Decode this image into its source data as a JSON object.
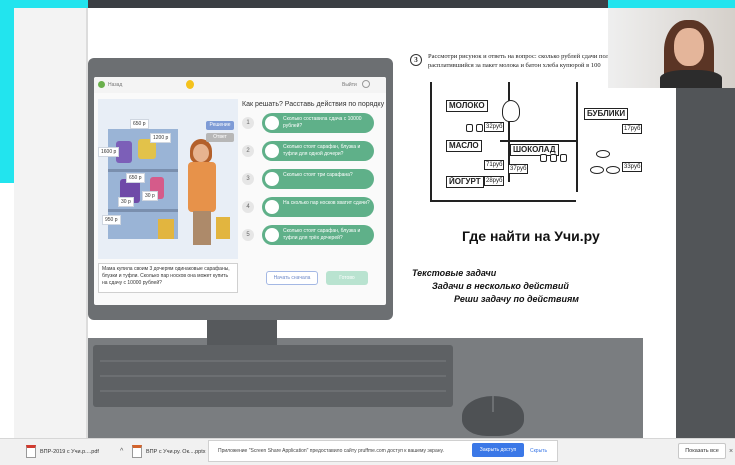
{
  "colors": {
    "cyan_frame": "#22e4ee",
    "step_green": "#5fb089",
    "share_blue": "#3b78e7",
    "monitor_gray": "#6c6f72"
  },
  "uchi_screen": {
    "back_label": "Назад",
    "exit_label": "Выйти",
    "question_title": "Как решать? Расставь действия по порядку",
    "prices": [
      "650 р",
      "1200 р",
      "1600 р",
      "650 р",
      "30 р",
      "30 р",
      "950 р"
    ],
    "side_tags": [
      "Решение",
      "Ответ"
    ],
    "task_text": "Мама купила своим 3 дочерям одинаковые сарафаны, блузки и туфли. Сколько пар носков она может купить на сдачу с 10000 рублей?",
    "steps": [
      {
        "num": "1",
        "text": "Сколько составила сдача с 10000 рублей?"
      },
      {
        "num": "2",
        "text": "Сколько стоят сарафан, блузка и туфли для одной дочери?"
      },
      {
        "num": "3",
        "text": "Сколько стоят три сарафана?"
      },
      {
        "num": "4",
        "text": "На сколько пар носков хватит сдачи?"
      },
      {
        "num": "5",
        "text": "Сколько стоят сарафан, блузка и туфли для трёх дочерей?"
      }
    ],
    "restart_label": "Начать сначала",
    "ready_label": "Готово"
  },
  "worksheet": {
    "problem_number": "3",
    "problem_text": "Рассмотри рисунок и ответь на вопрос: сколько рублей сдачи получит расплатившийся за пакет молока и батон хлеба купюрой в 100",
    "signs": [
      "МОЛОКО",
      "МАСЛО",
      "ЙОГУРТ",
      "ШОКОЛАД",
      "БУБЛИКИ"
    ],
    "tags": [
      "32руб",
      "71руб",
      "28руб",
      "37руб",
      "17руб",
      "33руб"
    ]
  },
  "heading": "Где найти на Учи.ру",
  "bullets": [
    "Текстовые задачи",
    "Задачи в несколько действий",
    "Реши задачу по действиям"
  ],
  "download_bar": {
    "items": [
      {
        "label": "ВПР-2019 с Учи.р....pdf",
        "icon": "pdf-file-icon"
      },
      {
        "label": "ВПР с Учи.ру. Ок....pptx",
        "icon": "pptx-file-icon"
      }
    ],
    "share_message": "Приложение \"Screen Share Application\" предоставило сайту pruffme.com доступ к вашему экрану.",
    "share_button": "Закрыть доступ",
    "share_cancel": "Скрыть",
    "show_all": "Показать все",
    "close_glyph": "×",
    "chevron_glyph": "^"
  }
}
